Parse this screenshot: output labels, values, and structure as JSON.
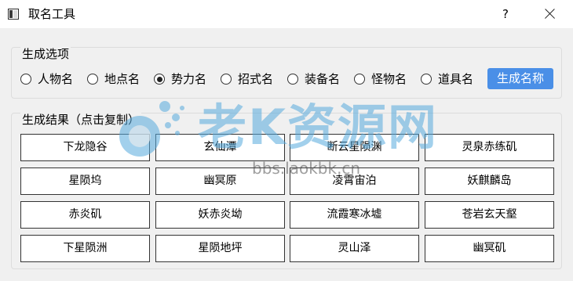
{
  "window": {
    "title": "取名工具",
    "help_label": "?",
    "close_icon": "close-icon"
  },
  "options": {
    "title": "生成选项",
    "radios": [
      {
        "label": "人物名",
        "checked": false
      },
      {
        "label": "地点名",
        "checked": false
      },
      {
        "label": "势力名",
        "checked": true
      },
      {
        "label": "招式名",
        "checked": false
      },
      {
        "label": "装备名",
        "checked": false
      },
      {
        "label": "怪物名",
        "checked": false
      },
      {
        "label": "道具名",
        "checked": false
      }
    ],
    "generate_label": "生成名称"
  },
  "results": {
    "title": "生成结果（点击复制）",
    "items": [
      [
        "下龙隐谷",
        "玄仙潭",
        "断云星陨渊",
        "灵泉赤练矶"
      ],
      [
        "星陨坞",
        "幽冥原",
        "凌霄宙泊",
        "妖麒麟岛"
      ],
      [
        "赤炎矶",
        "妖赤炎坳",
        "流霞寒冰墟",
        "苍岩玄天壑"
      ],
      [
        "下星陨洲",
        "星陨地坪",
        "灵山泽",
        "幽冥矶"
      ]
    ]
  },
  "watermark": {
    "text": "老K资源网",
    "url": "bbs.laokbk.cn"
  },
  "colors": {
    "accent": "#4a8fe7",
    "background": "#f0f0f0",
    "watermark": "#56aadc"
  }
}
